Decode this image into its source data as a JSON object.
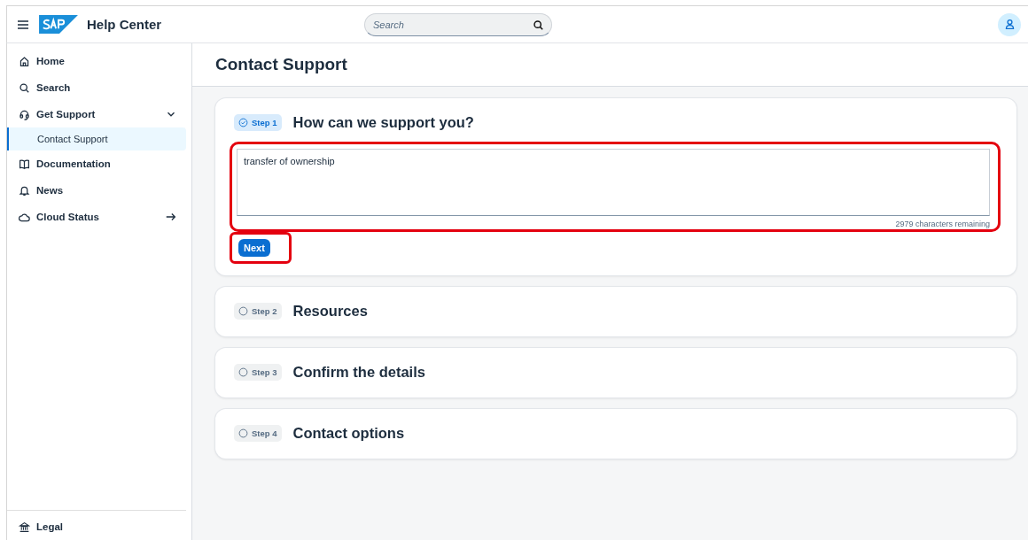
{
  "header": {
    "brand": "Help Center",
    "search": {
      "placeholder": "Search"
    }
  },
  "sidebar": {
    "items": [
      {
        "label": "Home",
        "selected": false
      },
      {
        "label": "Search",
        "selected": false
      },
      {
        "label": "Get Support",
        "selected": false,
        "expanded": true,
        "children": [
          {
            "label": "Contact Support",
            "selected": true
          }
        ]
      },
      {
        "label": "Documentation",
        "selected": false
      },
      {
        "label": "News",
        "selected": false
      },
      {
        "label": "Cloud Status",
        "selected": false,
        "external": true
      }
    ],
    "footer": {
      "label": "Legal"
    }
  },
  "page_title": "Contact Support",
  "steps": [
    {
      "badge": "Step 1",
      "title": "How can we support you?",
      "expanded": true,
      "field": {
        "value": "transfer of ownership",
        "counter": "2979 characters remaining",
        "highlighted": true
      },
      "button": {
        "label": "Next",
        "highlighted": true
      }
    },
    {
      "badge": "Step 2",
      "title": "Resources",
      "expanded": false
    },
    {
      "badge": "Step 3",
      "title": "Confirm the details",
      "expanded": false
    },
    {
      "badge": "Step 4",
      "title": "Contact options",
      "expanded": false
    }
  ]
}
